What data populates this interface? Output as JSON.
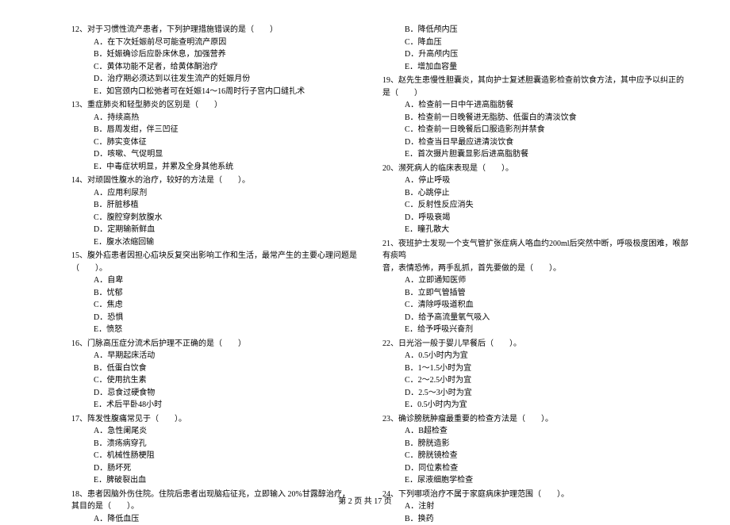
{
  "footer": "第 2 页 共 17 页",
  "left": {
    "q12": {
      "stem": "12、对于习惯性流产患者，下列护理措施错误的是（　　）",
      "A": "A．在下次妊娠前尽可能查明流产原因",
      "B": "B．妊娠确诊后应卧床休息，加强营养",
      "C": "C．黄体功能不足者，给黄体酮治疗",
      "D": "D．治疗期必须达到以往发生流产的妊娠月份",
      "E": "E．如宫颈内口松弛者可在妊娠14～16周时行子宫内口缝扎术"
    },
    "q13": {
      "stem": "13、重症肺炎和轻型肺炎的区别是（　　）",
      "A": "A．持续高热",
      "B": "B．唇周发绀，伴三凹征",
      "C": "C．肺实变体征",
      "D": "D．咳嗽、气促明显",
      "E": "E．中毒症状明显，并累及全身其他系统"
    },
    "q14": {
      "stem": "14、对顽固性腹水的治疗，较好的方法是（　　）。",
      "A": "A．应用利尿剂",
      "B": "B．肝脏移植",
      "C": "C．腹腔穿刺放腹水",
      "D": "D．定期输新鲜血",
      "E": "E．腹水浓缩回输"
    },
    "q15": {
      "stem": "15、腹外疝患者因担心疝块反复突出影响工作和生活，最常产生的主要心理问题是（　　）。",
      "A": "A．自卑",
      "B": "B．忧郁",
      "C": "C．焦虑",
      "D": "D．恐惧",
      "E": "E．愤怒"
    },
    "q16": {
      "stem": "16、门脉高压症分流术后护理不正确的是（　　）",
      "A": "A．早期起床活动",
      "B": "B．低蛋白饮食",
      "C": "C．使用抗生素",
      "D": "D．忌食过硬食物",
      "E": "E．术后平卧48小时"
    },
    "q17": {
      "stem": "17、阵发性腹痛常见于（　　）。",
      "A": "A．急性阑尾炎",
      "B": "B．溃疡病穿孔",
      "C": "C．机械性肠梗阻",
      "D": "D．肠坏死",
      "E": "E．脾破裂出血"
    },
    "q18": {
      "stem": "18、患者因脑外伤住院。住院后患者出现脑疝征兆，立即输入 20%甘露醇治疗，其目的是（　　）。",
      "A": "A．降低血压"
    }
  },
  "right": {
    "q18cont": {
      "B": "B．降低颅内压",
      "C": "C．降血压",
      "D": "D．升高颅内压",
      "E": "E．增加血容量"
    },
    "q19": {
      "stem": "19、赵先生患慢性胆囊炎，其向护士复述胆囊造影检查前饮食方法，其中应予以纠正的是（　　）",
      "A": "A．检查前一日中午进高脂肪餐",
      "B": "B．检查前一日晚餐进无脂肪、低蛋白的清淡饮食",
      "C": "C．检查前一日晚餐后口服造影剂并禁食",
      "D": "D．检查当日早最应进清淡饮食",
      "E": "E．首次摄片胆囊显影后进高脂肪餐"
    },
    "q20": {
      "stem": "20、濒死病人的临床表现是（　　）。",
      "A": "A．停止呼吸",
      "B": "B．心跳停止",
      "C": "C．反射性反应消失",
      "D": "D．呼吸衰竭",
      "E": "E．瞳孔散大"
    },
    "q21": {
      "stem1": "21、夜班护士发现一个支气管扩张症病人咯血约200ml后突然中断，呼吸极度困难，喉部有痰鸣",
      "stem2": "音，表情恐怖，两手乱抓，首先要做的是（　　）。",
      "A": "A．立即通知医师",
      "B": "B．立即气管插管",
      "C": "C．清除呼吸道积血",
      "D": "D．给予高流量氧气吸入",
      "E": "E．给予呼吸兴奋剂"
    },
    "q22": {
      "stem": "22、日光浴一般于婴儿早餐后（　　）。",
      "A": "A．0.5小时内为宜",
      "B": "B．1～1.5小时为宜",
      "C": "C．2～2.5小时为宜",
      "D": "D．2.5～3小时为宜",
      "E": "E．0.5小时内为宜"
    },
    "q23": {
      "stem": "23、确诊膀胱肿瘤最重要的检查方法是（　　）。",
      "A": "A．B超检查",
      "B": "B．膀胱造影",
      "C": "C．膀胱镜检查",
      "D": "D．同位素检查",
      "E": "E．尿液细胞学检查"
    },
    "q24": {
      "stem": "24、下列哪项治疗不属于家庭病床护理范围（　　）。",
      "A": "A．注射",
      "B": "B．换药"
    }
  }
}
